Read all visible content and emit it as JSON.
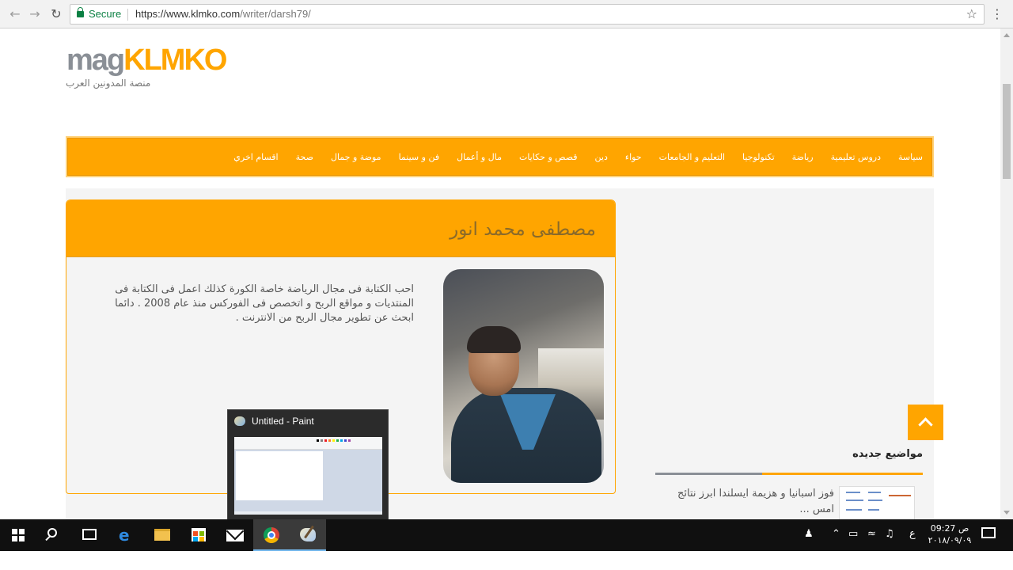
{
  "browser": {
    "secure_label": "Secure",
    "url_host": "https://www.klmko.com",
    "url_path": "/writer/darsh79/"
  },
  "site": {
    "logo_mag": "mag",
    "logo_klmko": "KLMKO",
    "tagline": "منصة المدونين العرب",
    "accent_color": "#ffa500"
  },
  "nav": {
    "items": [
      "سياسة",
      "دروس تعليمية",
      "رياضة",
      "تكنولوجيا",
      "التعليم و الجامعات",
      "حواء",
      "دين",
      "قصص و حكايات",
      "مال و أعمال",
      "فن و سينما",
      "موضة و جمال",
      "صحة",
      "اقسام اخري"
    ]
  },
  "author": {
    "name": "مصطفى محمد انور",
    "bio": "احب الكتابة فى مجال الرياضة خاصة الكورة كذلك اعمل فى الكتابة فى المنتديات و مواقع الربح و اتخصص فى الفوركس منذ عام 2008 . دائما ابحث عن تطوير مجال الربح من الانترنت ."
  },
  "sidebar": {
    "new_topics_title": "مواضيع جديده",
    "topic_title": "فوز اسبانيا و هزيمة ايسلندا ابرز نتائج امس ..."
  },
  "paint_popup": {
    "title": "Untitled - Paint"
  },
  "taskbar": {
    "lang": "ع",
    "time": "09:27 ص",
    "date": "٢٠١٨/٠٩/٠٩",
    "icons": [
      "windows-start-icon",
      "search-icon",
      "task-view-icon",
      "edge-icon",
      "file-explorer-icon",
      "store-icon",
      "mail-icon",
      "chrome-icon",
      "paint-icon"
    ]
  }
}
